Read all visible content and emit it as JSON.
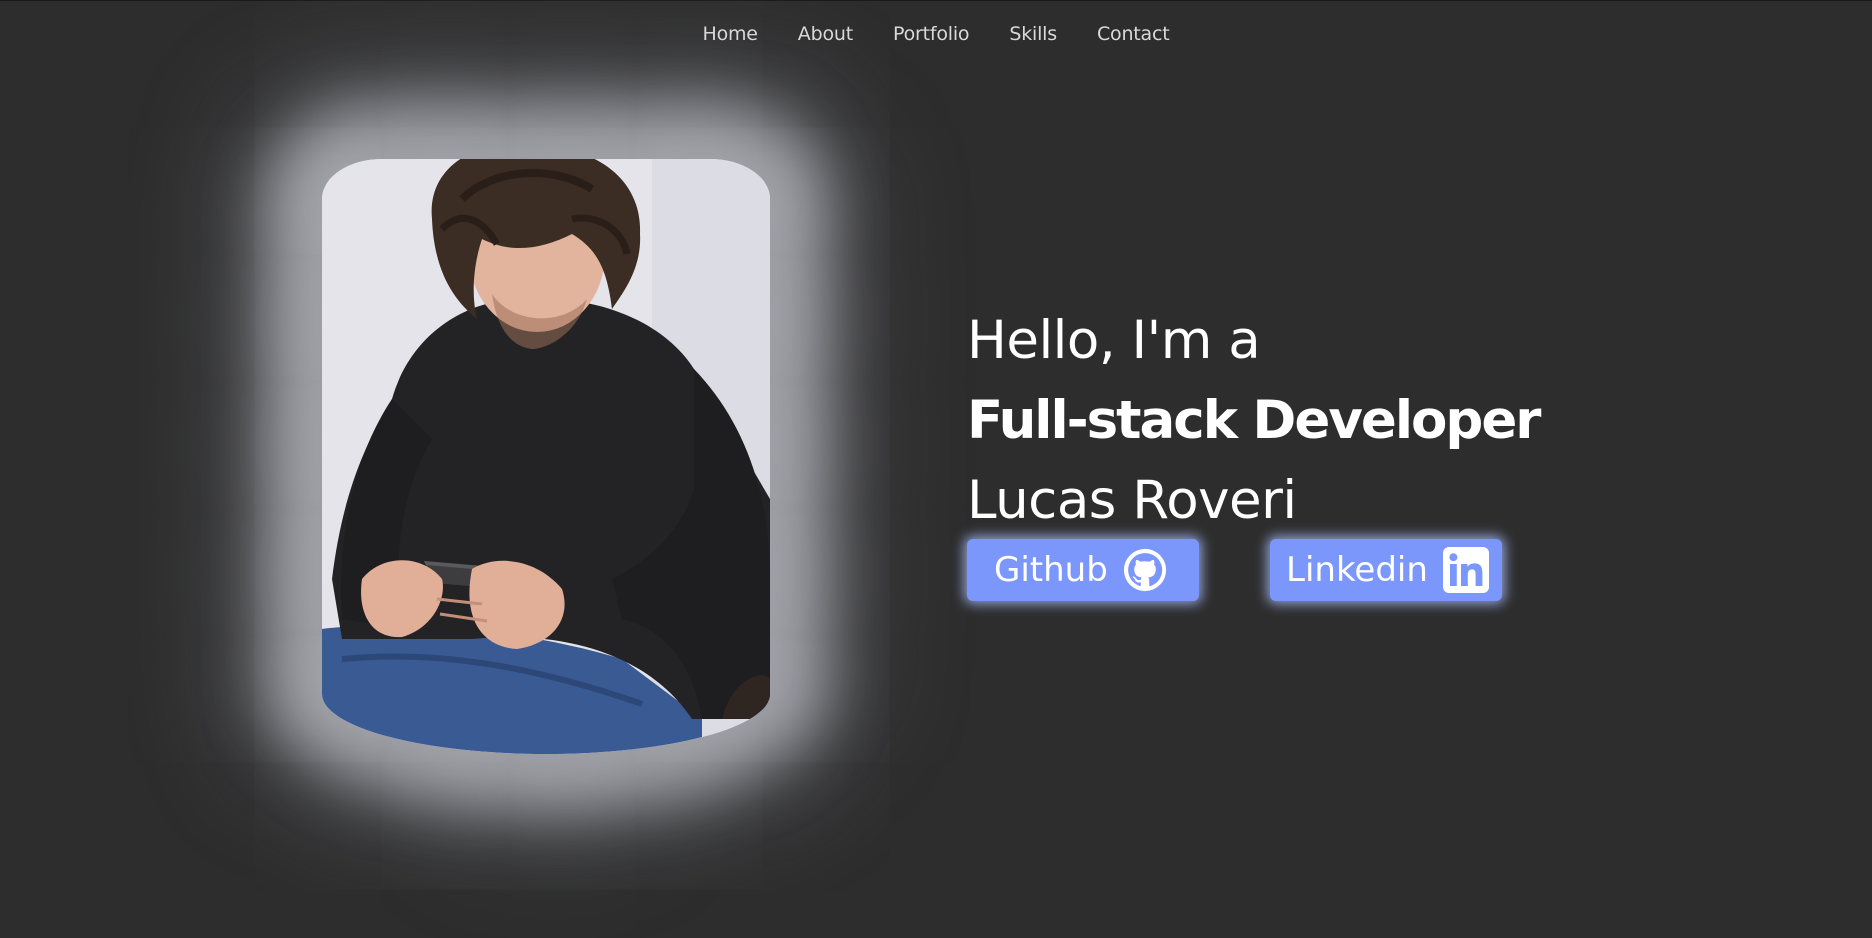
{
  "nav": {
    "items": [
      {
        "label": "Home"
      },
      {
        "label": "About"
      },
      {
        "label": "Portfolio"
      },
      {
        "label": "Skills"
      },
      {
        "label": "Contact"
      }
    ]
  },
  "hero": {
    "greeting": "Hello, I'm a",
    "role": "Full-stack Developer",
    "name": "Lucas Roveri"
  },
  "buttons": {
    "github_label": "Github",
    "github_icon": "github-icon",
    "linkedin_label": "Linkedin",
    "linkedin_icon": "linkedin-icon"
  },
  "colors": {
    "background": "#2d2d2d",
    "button": "#7c97fc",
    "text": "#ffffff",
    "nav_text": "#d9d9d9"
  }
}
